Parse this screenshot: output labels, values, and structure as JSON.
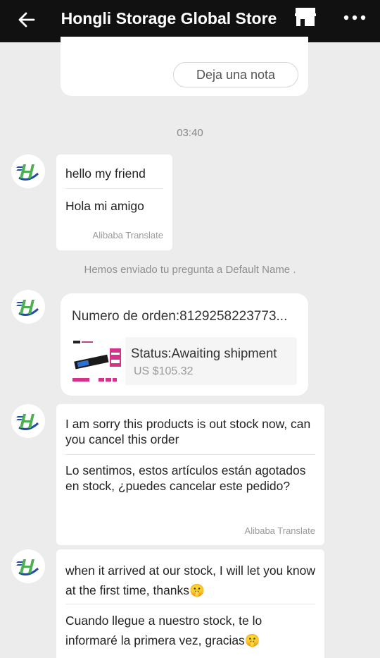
{
  "header": {
    "title": "Hongli Storage Global Store",
    "back_icon": "arrow-left-icon",
    "store_icon": "store-icon",
    "more_icon": "more-horizontal-icon"
  },
  "top_card": {
    "note_button": "Deja una nota"
  },
  "timestamp": "03:40",
  "system_message": "Hemos enviado tu pregunta a Default Name .",
  "messages": [
    {
      "original": "hello my friend",
      "translated": "Hola mi amigo",
      "translate_label": "Alibaba Translate"
    },
    {
      "original": "I am sorry this products is out stock now, can you cancel this order",
      "translated": "Lo sentimos, estos artículos están agotados en stock, ¿puedes cancelar este pedido?",
      "translate_label": "Alibaba Translate"
    },
    {
      "original": "when it arrived at our stock, I will let you know at the first time, thanks🤫",
      "translated": "Cuando llegue a nuestro stock, te lo informaré la primera vez, gracias🤫"
    }
  ],
  "order": {
    "number_label": "Numero de orden:8129258223773...",
    "status": "Status:Awaiting shipment",
    "price": "US $105.32"
  },
  "colors": {
    "header_bg": "#111111",
    "page_bg": "#ececec",
    "logo_blue": "#1f4fa8",
    "logo_green": "#4caf50"
  }
}
